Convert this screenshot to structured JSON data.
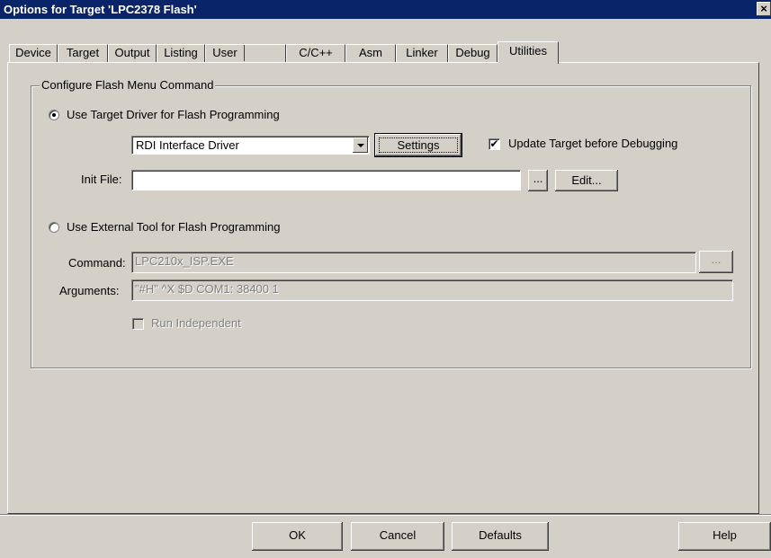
{
  "window": {
    "title": "Options for Target 'LPC2378 Flash'",
    "close_glyph": "×"
  },
  "tabs": [
    {
      "label": "Device"
    },
    {
      "label": "Target"
    },
    {
      "label": "Output"
    },
    {
      "label": "Listing"
    },
    {
      "label": "User"
    },
    {
      "label": "C/C++"
    },
    {
      "label": "Asm"
    },
    {
      "label": "Linker"
    },
    {
      "label": "Debug"
    },
    {
      "label": "Utilities",
      "active": true
    }
  ],
  "group": {
    "title": "Configure Flash Menu Command",
    "target_driver": {
      "label": "Use Target Driver for Flash Programming",
      "selected": true,
      "driver_value": "RDI Interface Driver",
      "settings_label": "Settings",
      "update_target_label": "Update Target before Debugging",
      "update_target_checked": true,
      "init_file_label": "Init File:",
      "init_file_value": "",
      "browse_label": "...",
      "edit_label": "Edit..."
    },
    "external_tool": {
      "label": "Use External Tool for Flash Programming",
      "selected": false,
      "command_label": "Command:",
      "command_value": "LPC210x_ISP.EXE",
      "browse_label": "...",
      "arguments_label": "Arguments:",
      "arguments_value": "\"#H\" ^X $D COM1: 38400 1",
      "run_independent_label": "Run Independent",
      "run_independent_checked": false
    }
  },
  "footer": {
    "ok": "OK",
    "cancel": "Cancel",
    "defaults": "Defaults",
    "help": "Help"
  },
  "icons": {
    "check": "✔"
  }
}
